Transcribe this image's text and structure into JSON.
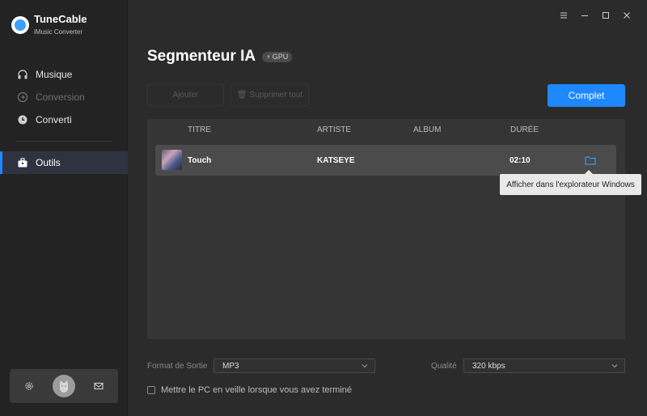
{
  "app": {
    "name": "TuneCable",
    "subtitle": "iMusic Converter"
  },
  "sidebar": {
    "items": [
      {
        "label": "Musique",
        "icon": "headphones-icon",
        "state": "normal"
      },
      {
        "label": "Conversion",
        "icon": "convert-icon",
        "state": "disabled"
      },
      {
        "label": "Converti",
        "icon": "clock-icon",
        "state": "normal"
      },
      {
        "label": "Outils",
        "icon": "toolbox-icon",
        "state": "active"
      }
    ],
    "bottom_icons": [
      "settings-icon",
      "avatar",
      "mail-icon"
    ]
  },
  "window_controls": [
    "menu-icon",
    "minimize-icon",
    "maximize-icon",
    "close-icon"
  ],
  "page": {
    "title": "Segmenteur IA",
    "badge": "GPU"
  },
  "toolbar": {
    "add_label": "Ajouter",
    "delete_all_label": "Supprimer tout",
    "complete_label": "Complet"
  },
  "table": {
    "headers": {
      "title": "TITRE",
      "artist": "ARTISTE",
      "album": "ALBUM",
      "duration": "DURÉE"
    },
    "rows": [
      {
        "title": "Touch",
        "artist": "KATSEYE",
        "album": "",
        "duration": "02:10"
      }
    ]
  },
  "tooltip": {
    "text": "Afficher dans l'explorateur Windows"
  },
  "output": {
    "format_label": "Format de Sortie",
    "format_value": "MP3",
    "quality_label": "Qualité",
    "quality_value": "320 kbps"
  },
  "sleep_option": {
    "label": "Mettre le PC en veille lorsque vous avez terminé",
    "checked": false
  },
  "colors": {
    "accent": "#1e88ff",
    "sidebar_bg": "#232323",
    "main_bg": "#2b2b2b"
  }
}
